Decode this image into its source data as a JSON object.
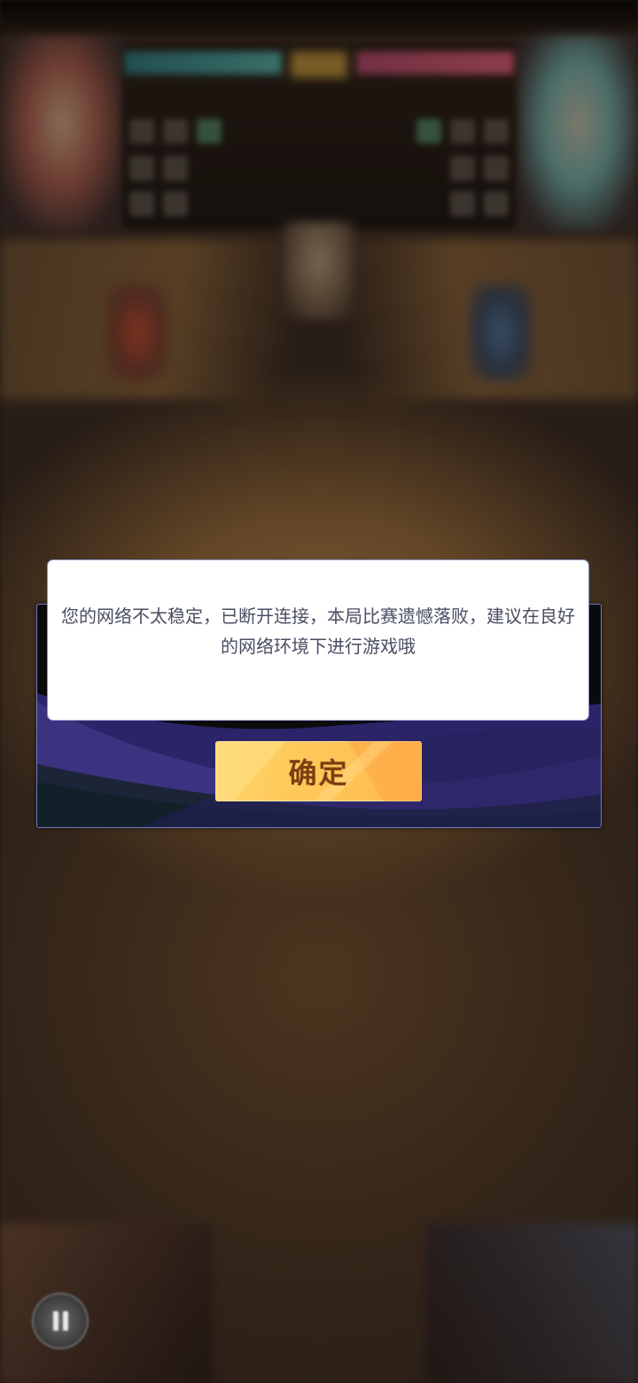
{
  "dialog": {
    "message": "您的网络不太稳定，已断开连接，本局比赛遗憾落败，建议在良好的网络环境下进行游戏哦",
    "confirm_label": "确定"
  },
  "icons": {
    "pause": "pause-icon"
  },
  "colors": {
    "dialog_text": "#4a4e62",
    "confirm_button": "#ffc95a",
    "confirm_text": "#7a3e12",
    "frame_accent": "#3b2f82"
  }
}
